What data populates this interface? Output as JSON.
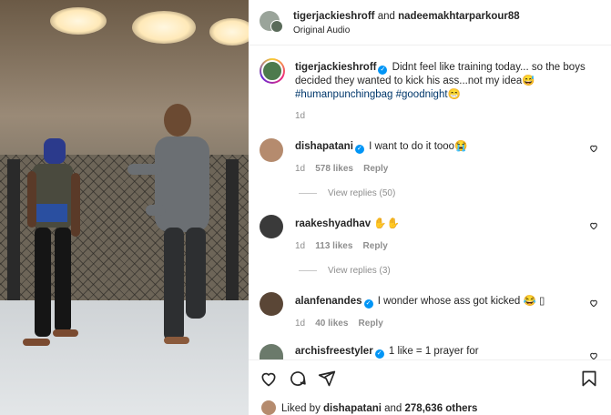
{
  "header": {
    "user1": "tigerjackieshroff",
    "and": "and",
    "user2": "nadeemakhtarparkour88",
    "audio": "Original Audio"
  },
  "caption": {
    "username": "tigerjackieshroff",
    "text": " Didnt feel like training today... so the boys decided they wanted to kick his ass...not my idea😅",
    "hashtags": "#humanpunchingbag #goodnight😁",
    "time": "1d"
  },
  "comments": [
    {
      "username": "dishapatani",
      "text": " I want to do it tooo😭",
      "time": "1d",
      "likes": "578 likes",
      "reply": "Reply",
      "view_replies": "View replies (50)"
    },
    {
      "username": "raakeshyadhav",
      "text": " ✋✋",
      "time": "1d",
      "likes": "113 likes",
      "reply": "Reply",
      "view_replies": "View replies (3)"
    },
    {
      "username": "alanfenandes",
      "text": " I wonder whose ass got kicked 😂 ▯",
      "time": "1d",
      "likes": "40 likes",
      "reply": "Reply"
    },
    {
      "username": "archisfreestyler",
      "text": " 1 like = 1 prayer for"
    }
  ],
  "likes_bar": {
    "prefix": "Liked by ",
    "user": "dishapatani",
    "suffix": " and ",
    "count": "278,636 others"
  },
  "colors": {
    "link": "#00376b",
    "verified": "#0095f6",
    "muted": "#8e8e8e"
  },
  "icons": [
    "heart-icon",
    "comment-icon",
    "share-icon",
    "bookmark-icon",
    "verified-icon"
  ]
}
